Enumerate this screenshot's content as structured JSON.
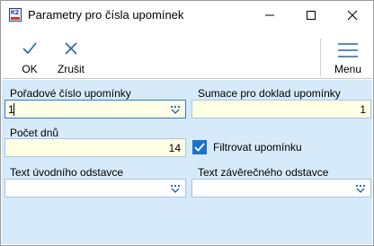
{
  "window": {
    "title": "Parametry pro čísla upomínek",
    "icon": "k2-app-icon",
    "controls": [
      "minimize-icon",
      "maximize-icon",
      "close-icon"
    ]
  },
  "toolbar": {
    "ok_label": "OK",
    "cancel_label": "Zrušit",
    "menu_label": "Menu"
  },
  "form": {
    "poradove_cislo": {
      "label": "Pořadové číslo upomínky",
      "value": "1"
    },
    "sumace": {
      "label": "Sumace pro doklad upomínky",
      "value": "1"
    },
    "pocet_dnu": {
      "label": "Počet dnů",
      "value": "14"
    },
    "filtrovat": {
      "label": "Filtrovat upomínku",
      "checked": true
    },
    "text_uvodni": {
      "label": "Text úvodního odstavce",
      "value": ""
    },
    "text_zaverecny": {
      "label": "Text závěrečného odstavce",
      "value": ""
    }
  },
  "colors": {
    "accent": "#1e73c8",
    "form_bg": "#d6eaf9",
    "input_yellow": "#ffffe6"
  }
}
